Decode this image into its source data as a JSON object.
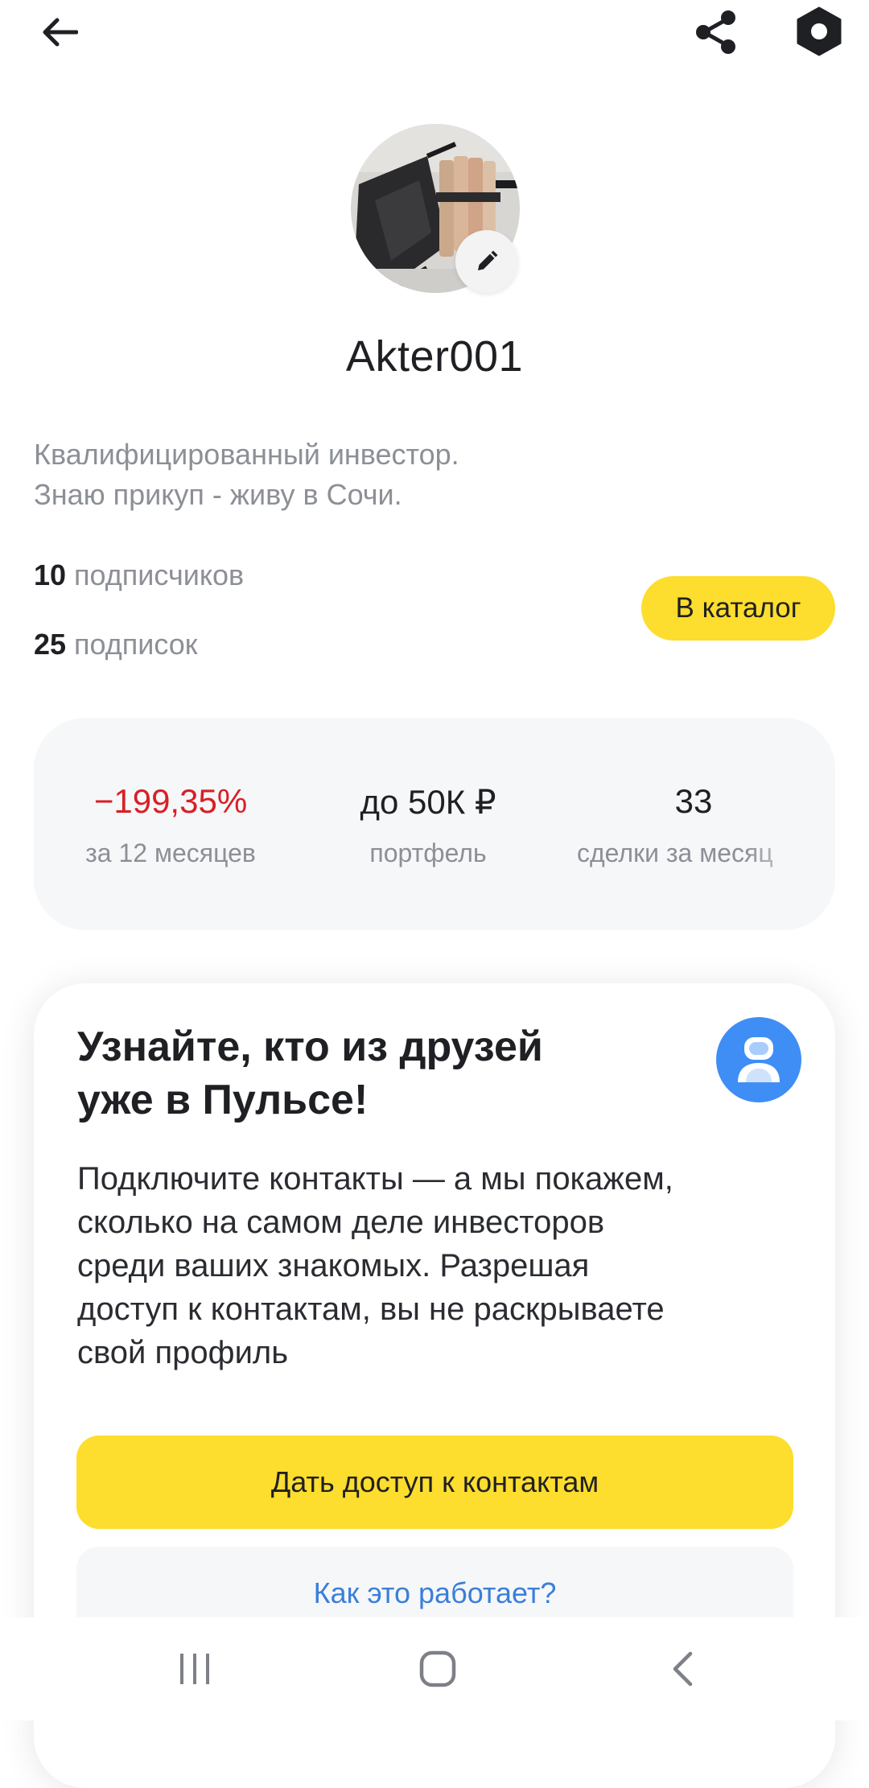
{
  "header": {
    "back_icon": "arrow-left-icon",
    "share_icon": "share-icon",
    "settings_icon": "hexagon-settings-icon"
  },
  "profile": {
    "avatar_icon": "edit-pencil-icon",
    "username": "Akter001",
    "bio_lines": [
      "Квалифицированный инвестор.",
      "Знаю прикуп - живу в Сочи."
    ],
    "followers_count": "10",
    "followers_label": "подписчиков",
    "following_count": "25",
    "following_label": "подписок",
    "catalog_button": "В каталог"
  },
  "stats": [
    {
      "value": "−199,35%",
      "label": "за 12 месяцев",
      "status": "negative"
    },
    {
      "value": "до 50К ₽",
      "label": "портфель"
    },
    {
      "value": "33",
      "label": "сделки за месяц"
    }
  ],
  "invite_card": {
    "title_lines": [
      "Узнайте, кто из друзей",
      "уже в Пульсе!"
    ],
    "icon": "contacts-person-icon",
    "text_lines": [
      "Подключите контакты — а мы покажем,",
      "сколько на самом деле инвесторов",
      "среди ваших знакомых. Разрешая",
      "доступ к контактам, вы не раскрываете",
      "свой профиль"
    ],
    "primary_button": "Дать доступ к контактам",
    "secondary_button": "Как это работает?"
  },
  "system_nav": {
    "recents_icon": "recents-icon",
    "home_icon": "home-icon",
    "back_icon": "back-chevron-icon"
  },
  "colors": {
    "accent_yellow": "#fddd2d",
    "negative_red": "#d91f26",
    "link_blue": "#3a7fd9",
    "icon_blue": "#3f8ef5",
    "muted_text": "#8c8f96"
  }
}
